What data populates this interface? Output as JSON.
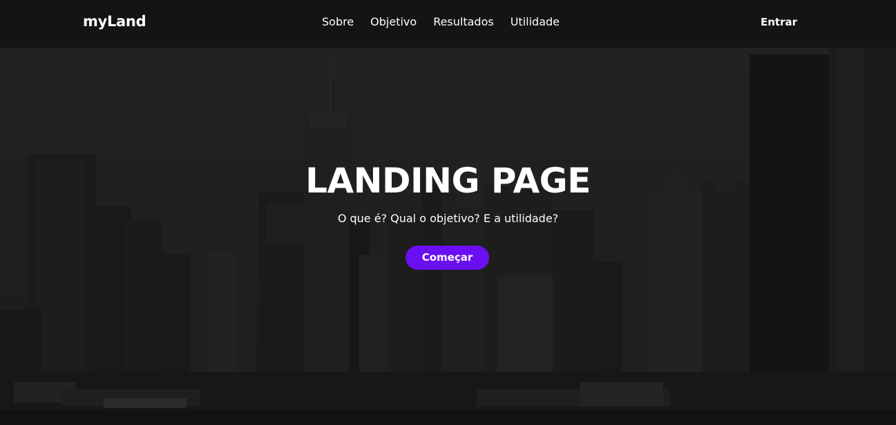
{
  "header": {
    "logo": "myLand",
    "nav": [
      "Sobre",
      "Objetivo",
      "Resultados",
      "Utilidade"
    ],
    "login_label": "Entrar"
  },
  "hero": {
    "title": "LANDING PAGE",
    "subtitle": "O que é? Qual o objetivo? E a utilidade?",
    "cta_label": "Começar",
    "background": "grayscale city skyline photo"
  },
  "colors": {
    "navbar_bg": "#141414",
    "cta_bg": "#6a0ff2",
    "text": "#ffffff"
  }
}
